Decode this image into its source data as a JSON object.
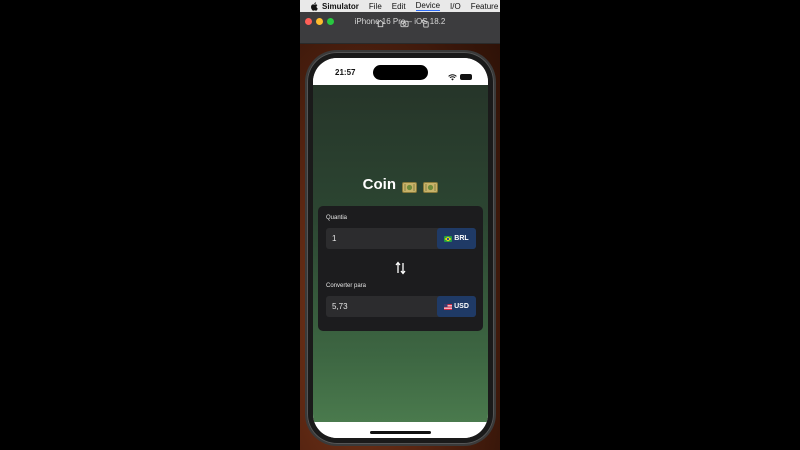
{
  "menubar": {
    "app_name": "Simulator",
    "items": [
      "File",
      "Edit",
      "Device",
      "I/O",
      "Feature"
    ]
  },
  "window": {
    "title": "iPhone 16 Pro – iOS 18.2"
  },
  "status_bar": {
    "time": "21:57"
  },
  "app": {
    "title": "Coin",
    "amount_label": "Quantia",
    "amount_value": "1",
    "from_currency": "BRL",
    "convert_label": "Converter para",
    "converted_value": "5,73",
    "to_currency": "USD"
  },
  "colors": {
    "gradient_top": "#263529",
    "gradient_bottom": "#4a7a4d",
    "card": "#1c1c1e",
    "field": "#2c2c2e",
    "currency_button": "#1f3a66"
  }
}
